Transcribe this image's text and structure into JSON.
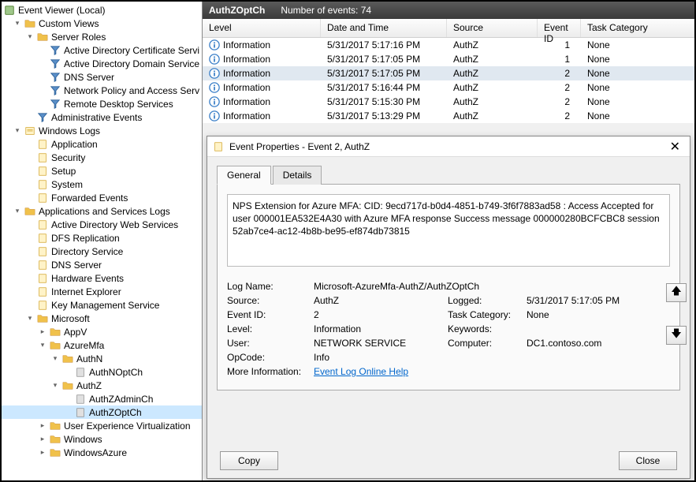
{
  "tree": {
    "root": "Event Viewer (Local)",
    "custom_views": "Custom Views",
    "server_roles": "Server Roles",
    "adcs": "Active Directory Certificate Servi",
    "adds": "Active Directory Domain Service",
    "dns": "DNS Server",
    "nps": "Network Policy and Access Serv",
    "rds": "Remote Desktop Services",
    "admin_events": "Administrative Events",
    "windows_logs": "Windows Logs",
    "application": "Application",
    "security": "Security",
    "setup": "Setup",
    "system": "System",
    "forwarded": "Forwarded Events",
    "apps_services": "Applications and Services Logs",
    "adws": "Active Directory Web Services",
    "dfsr": "DFS Replication",
    "dirsvc": "Directory Service",
    "dnssvr": "DNS Server",
    "hwevents": "Hardware Events",
    "ie": "Internet Explorer",
    "kms": "Key Management Service",
    "microsoft": "Microsoft",
    "appv": "AppV",
    "azuremfa": "AzureMfa",
    "authn": "AuthN",
    "authnopt": "AuthNOptCh",
    "authz": "AuthZ",
    "authzadmin": "AuthZAdminCh",
    "authzopt": "AuthZOptCh",
    "uev": "User Experience Virtualization",
    "windows": "Windows",
    "winazure": "WindowsAzure"
  },
  "header": {
    "log_name": "AuthZOptCh",
    "count_label": "Number of events: 74"
  },
  "columns": {
    "level": "Level",
    "date": "Date and Time",
    "source": "Source",
    "eventid": "Event ID",
    "task": "Task Category"
  },
  "events": [
    {
      "level": "Information",
      "date": "5/31/2017 5:17:16 PM",
      "source": "AuthZ",
      "eventid": "1",
      "task": "None",
      "selected": false
    },
    {
      "level": "Information",
      "date": "5/31/2017 5:17:05 PM",
      "source": "AuthZ",
      "eventid": "1",
      "task": "None",
      "selected": false
    },
    {
      "level": "Information",
      "date": "5/31/2017 5:17:05 PM",
      "source": "AuthZ",
      "eventid": "2",
      "task": "None",
      "selected": true
    },
    {
      "level": "Information",
      "date": "5/31/2017 5:16:44 PM",
      "source": "AuthZ",
      "eventid": "2",
      "task": "None",
      "selected": false
    },
    {
      "level": "Information",
      "date": "5/31/2017 5:15:30 PM",
      "source": "AuthZ",
      "eventid": "2",
      "task": "None",
      "selected": false
    },
    {
      "level": "Information",
      "date": "5/31/2017 5:13:29 PM",
      "source": "AuthZ",
      "eventid": "2",
      "task": "None",
      "selected": false
    }
  ],
  "dialog": {
    "title": "Event Properties - Event 2, AuthZ",
    "tabs": {
      "general": "General",
      "details": "Details"
    },
    "description": "NPS Extension for Azure MFA:  CID: 9ecd717d-b0d4-4851-b749-3f6f7883ad58 : Access Accepted for user 000001EA532E4A30 with Azure MFA response Success message 000000280BCFCBC8 session 52ab7ce4-ac12-4b8b-be95-ef874db73815",
    "fields": {
      "logname_label": "Log Name:",
      "logname": "Microsoft-AzureMfa-AuthZ/AuthZOptCh",
      "source_label": "Source:",
      "source": "AuthZ",
      "logged_label": "Logged:",
      "logged": "5/31/2017 5:17:05 PM",
      "eventid_label": "Event ID:",
      "eventid": "2",
      "task_label": "Task Category:",
      "task": "None",
      "level_label": "Level:",
      "level": "Information",
      "keywords_label": "Keywords:",
      "keywords": "",
      "user_label": "User:",
      "user": "NETWORK SERVICE",
      "computer_label": "Computer:",
      "computer": "DC1.contoso.com",
      "opcode_label": "OpCode:",
      "opcode": "Info",
      "moreinfo_label": "More Information:",
      "moreinfo_link": "Event Log Online Help"
    },
    "buttons": {
      "copy": "Copy",
      "close": "Close"
    }
  }
}
